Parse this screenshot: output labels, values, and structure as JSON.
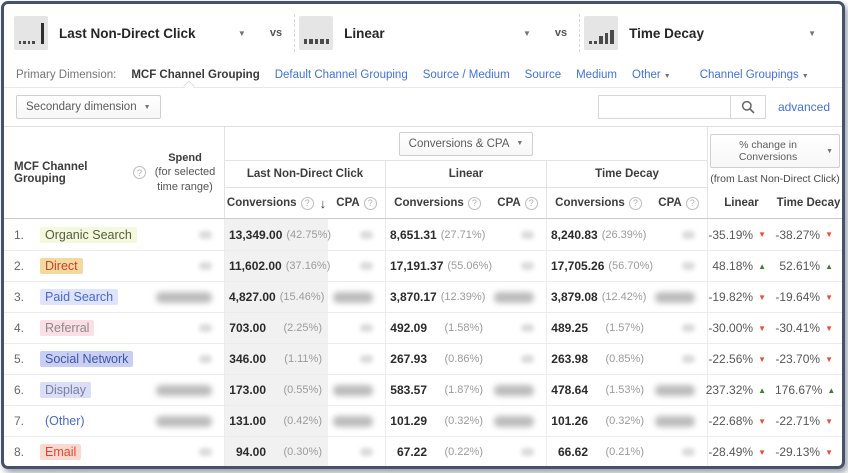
{
  "colors": {
    "link_blue": "#4272d7",
    "positive_green": "#3e7d32",
    "negative_red": "#e8503a",
    "sorted_column_bg": "#f1f1f1",
    "frame": "#46526b"
  },
  "icons": {
    "caret": "▼",
    "sort_desc": "↓",
    "help": "?",
    "up_arrow": "▲",
    "down_arrow": "▼"
  },
  "models": {
    "vs": "vs",
    "items": [
      {
        "name": "Last Non-Direct Click"
      },
      {
        "name": "Linear"
      },
      {
        "name": "Time Decay"
      }
    ]
  },
  "dimension_bar": {
    "label": "Primary Dimension:",
    "selected": "MCF Channel Grouping",
    "links": [
      "Default Channel Grouping",
      "Source / Medium",
      "Source",
      "Medium"
    ],
    "other": "Other",
    "channel_groupings": "Channel Groupings"
  },
  "toolbar": {
    "secondary_dimension": "Secondary dimension",
    "search_value": "",
    "advanced": "advanced"
  },
  "table": {
    "header": {
      "dimension": "MCF Channel Grouping",
      "spend_title": "Spend",
      "spend_sub": "(for selected time range)",
      "metric_selector": "Conversions & CPA",
      "groups": [
        "Last Non-Direct Click",
        "Linear",
        "Time Decay"
      ],
      "conversions": "Conversions",
      "cpa": "CPA",
      "pct_selector": "% change in Conversions",
      "pct_sub": "(from Last Non-Direct Click)",
      "pct_columns": [
        "Linear",
        "Time Decay"
      ]
    },
    "rows": [
      {
        "rank": "1.",
        "channel": "Organic Search",
        "chip_bg": "#f3f9da",
        "chip_color": "#555b45",
        "blur": "small",
        "lndc": {
          "value": "13,349.00",
          "pct": "(42.75%)"
        },
        "linear": {
          "value": "8,651.31",
          "pct": "(27.71%)"
        },
        "time_decay": {
          "value": "8,240.83",
          "pct": "(26.39%)"
        },
        "change_linear": {
          "value": "-35.19%",
          "dir": "down"
        },
        "change_time_decay": {
          "value": "-38.27%",
          "dir": "down"
        }
      },
      {
        "rank": "2.",
        "channel": "Direct",
        "chip_bg": "#f2d99f",
        "chip_color": "#c9402a",
        "blur": "small",
        "lndc": {
          "value": "11,602.00",
          "pct": "(37.16%)"
        },
        "linear": {
          "value": "17,191.37",
          "pct": "(55.06%)"
        },
        "time_decay": {
          "value": "17,705.26",
          "pct": "(56.70%)"
        },
        "change_linear": {
          "value": "48.18%",
          "dir": "up"
        },
        "change_time_decay": {
          "value": "52.61%",
          "dir": "up"
        }
      },
      {
        "rank": "3.",
        "channel": "Paid Search",
        "chip_bg": "#dde4fb",
        "chip_color": "#4968d2",
        "blur": "large",
        "lndc": {
          "value": "4,827.00",
          "pct": "(15.46%)"
        },
        "linear": {
          "value": "3,870.17",
          "pct": "(12.39%)"
        },
        "time_decay": {
          "value": "3,879.08",
          "pct": "(12.42%)"
        },
        "change_linear": {
          "value": "-19.82%",
          "dir": "down"
        },
        "change_time_decay": {
          "value": "-19.64%",
          "dir": "down"
        }
      },
      {
        "rank": "4.",
        "channel": "Referral",
        "chip_bg": "#fadfe6",
        "chip_color": "#8a8a8a",
        "blur": "small",
        "lndc": {
          "value": "703.00",
          "pct": "(2.25%)"
        },
        "linear": {
          "value": "492.09",
          "pct": "(1.58%)"
        },
        "time_decay": {
          "value": "489.25",
          "pct": "(1.57%)"
        },
        "change_linear": {
          "value": "-30.00%",
          "dir": "down"
        },
        "change_time_decay": {
          "value": "-30.41%",
          "dir": "down"
        }
      },
      {
        "rank": "5.",
        "channel": "Social Network",
        "chip_bg": "#c8cff2",
        "chip_color": "#3d55ad",
        "blur": "small",
        "lndc": {
          "value": "346.00",
          "pct": "(1.11%)"
        },
        "linear": {
          "value": "267.93",
          "pct": "(0.86%)"
        },
        "time_decay": {
          "value": "263.98",
          "pct": "(0.85%)"
        },
        "change_linear": {
          "value": "-22.56%",
          "dir": "down"
        },
        "change_time_decay": {
          "value": "-23.70%",
          "dir": "down"
        }
      },
      {
        "rank": "6.",
        "channel": "Display",
        "chip_bg": "#dadef6",
        "chip_color": "#7a80a0",
        "blur": "large",
        "lndc": {
          "value": "173.00",
          "pct": "(0.55%)"
        },
        "linear": {
          "value": "583.57",
          "pct": "(1.87%)"
        },
        "time_decay": {
          "value": "478.64",
          "pct": "(1.53%)"
        },
        "change_linear": {
          "value": "237.32%",
          "dir": "up"
        },
        "change_time_decay": {
          "value": "176.67%",
          "dir": "up"
        }
      },
      {
        "rank": "7.",
        "channel": "(Other)",
        "chip_bg": "",
        "chip_color": "#4968d2",
        "blur": "large",
        "lndc": {
          "value": "131.00",
          "pct": "(0.42%)"
        },
        "linear": {
          "value": "101.29",
          "pct": "(0.32%)"
        },
        "time_decay": {
          "value": "101.26",
          "pct": "(0.32%)"
        },
        "change_linear": {
          "value": "-22.68%",
          "dir": "down"
        },
        "change_time_decay": {
          "value": "-22.71%",
          "dir": "down"
        }
      },
      {
        "rank": "8.",
        "channel": "Email",
        "chip_bg": "#fcd9d0",
        "chip_color": "#e0482b",
        "blur": "small",
        "lndc": {
          "value": "94.00",
          "pct": "(0.30%)"
        },
        "linear": {
          "value": "67.22",
          "pct": "(0.22%)"
        },
        "time_decay": {
          "value": "66.62",
          "pct": "(0.21%)"
        },
        "change_linear": {
          "value": "-28.49%",
          "dir": "down"
        },
        "change_time_decay": {
          "value": "-29.13%",
          "dir": "down"
        }
      }
    ]
  }
}
